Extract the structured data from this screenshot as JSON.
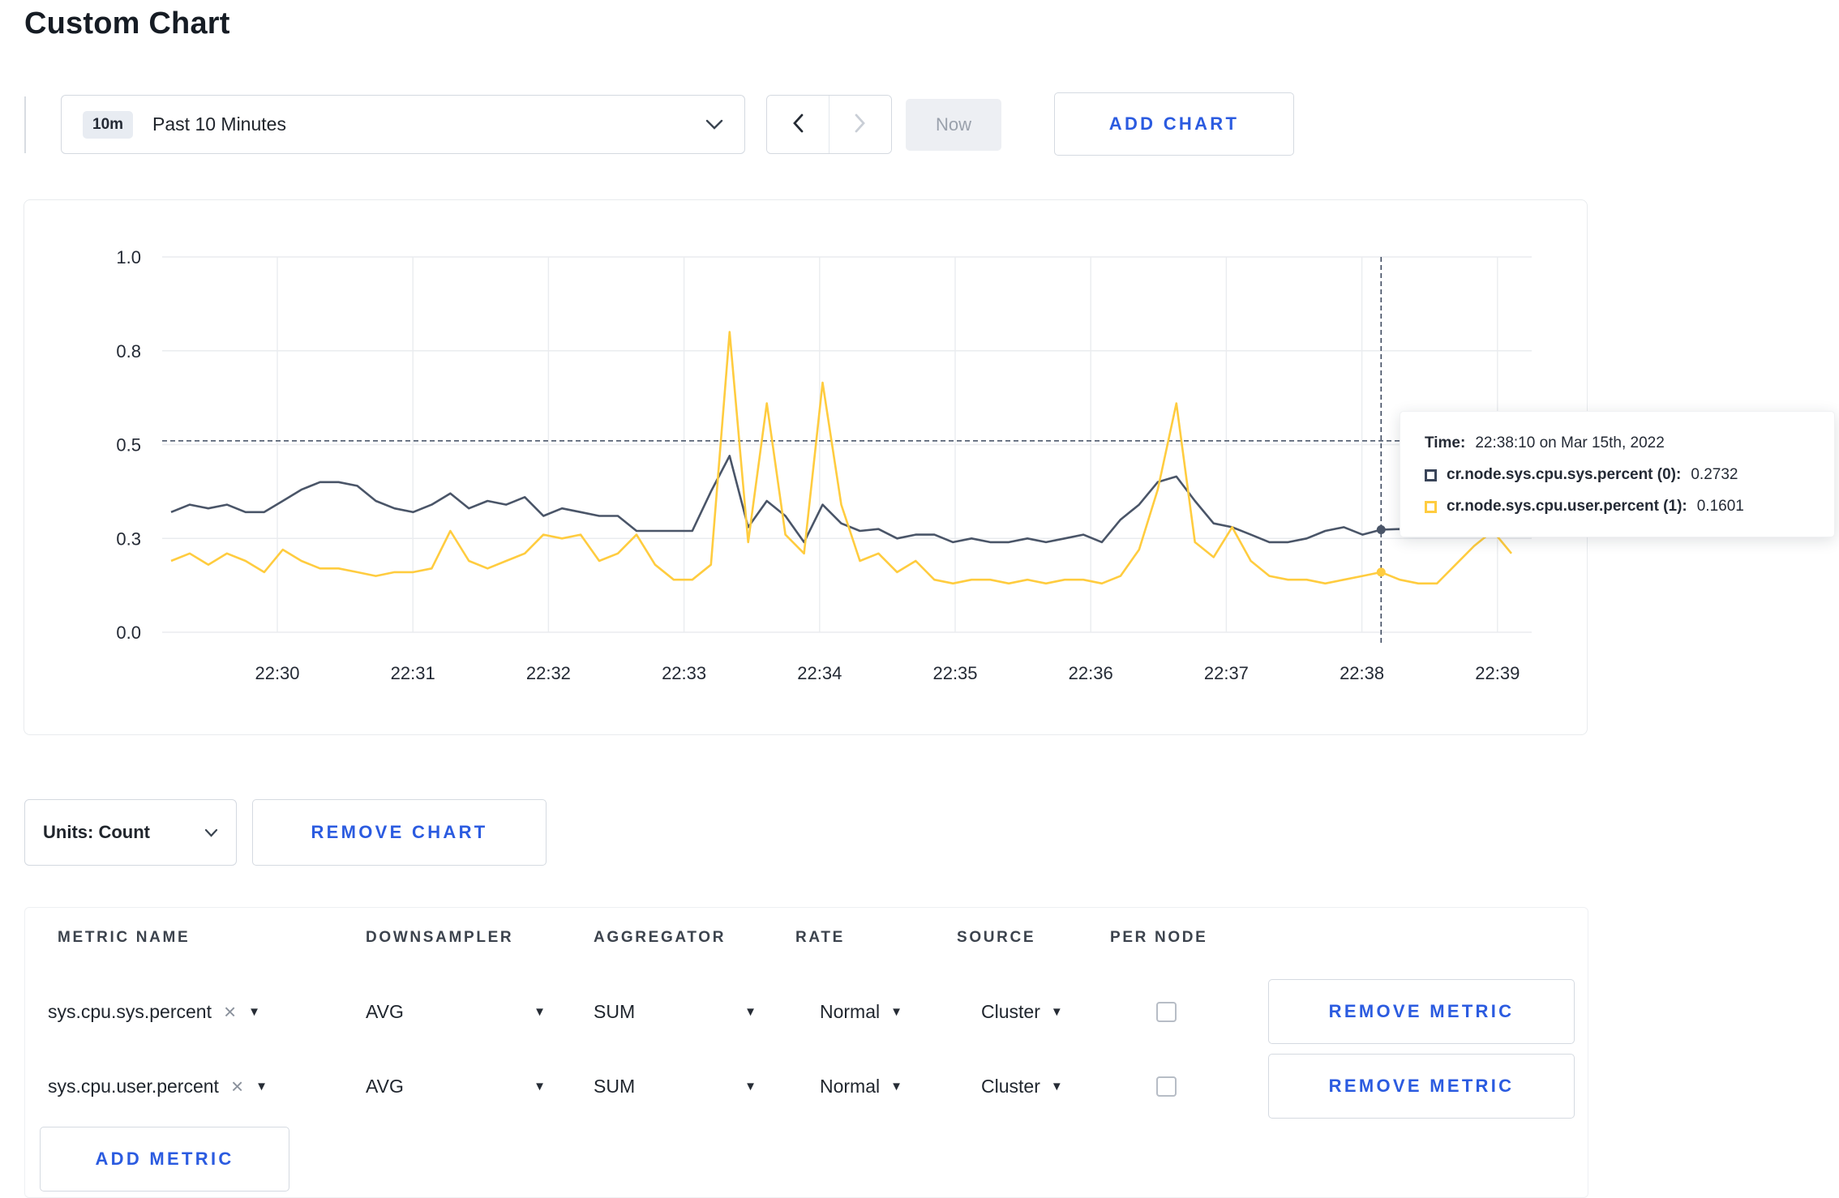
{
  "page": {
    "title": "Custom Chart"
  },
  "toolbar": {
    "time_range": {
      "badge": "10m",
      "label": "Past 10 Minutes"
    },
    "now_label": "Now",
    "add_chart_label": "ADD CHART"
  },
  "chart_data": {
    "type": "line",
    "x_tick_labels": [
      "22:30",
      "22:31",
      "22:32",
      "22:33",
      "22:34",
      "22:35",
      "22:36",
      "22:37",
      "22:38",
      "22:39"
    ],
    "y_ticks": [
      {
        "v": 0,
        "label": "0.0"
      },
      {
        "v": 0.25,
        "label": "0.3"
      },
      {
        "v": 0.5,
        "label": "0.5"
      },
      {
        "v": 0.75,
        "label": "0.8"
      },
      {
        "v": 1,
        "label": "1.0"
      }
    ],
    "ylim": [
      0,
      1
    ],
    "grid": true,
    "series": [
      {
        "name": "cr.node.sys.cpu.sys.percent",
        "color": "#4a5568",
        "values": [
          0.32,
          0.34,
          0.33,
          0.34,
          0.32,
          0.32,
          0.35,
          0.38,
          0.4,
          0.4,
          0.39,
          0.35,
          0.33,
          0.32,
          0.34,
          0.37,
          0.33,
          0.35,
          0.34,
          0.36,
          0.31,
          0.33,
          0.32,
          0.31,
          0.31,
          0.27,
          0.27,
          0.27,
          0.27,
          0.375,
          0.47,
          0.28,
          0.35,
          0.31,
          0.24,
          0.34,
          0.29,
          0.27,
          0.275,
          0.25,
          0.26,
          0.26,
          0.24,
          0.25,
          0.24,
          0.24,
          0.25,
          0.24,
          0.25,
          0.26,
          0.24,
          0.3,
          0.34,
          0.4,
          0.415,
          0.35,
          0.29,
          0.28,
          0.26,
          0.24,
          0.24,
          0.25,
          0.27,
          0.28,
          0.26,
          0.2732,
          0.275,
          0.26,
          0.275,
          0.27,
          0.28,
          0.275,
          0.29
        ]
      },
      {
        "name": "cr.node.sys.cpu.user.percent",
        "color": "#ffcc3f",
        "values": [
          0.19,
          0.21,
          0.18,
          0.21,
          0.19,
          0.16,
          0.22,
          0.19,
          0.17,
          0.17,
          0.16,
          0.15,
          0.16,
          0.16,
          0.17,
          0.27,
          0.19,
          0.17,
          0.19,
          0.21,
          0.26,
          0.25,
          0.26,
          0.19,
          0.21,
          0.26,
          0.18,
          0.14,
          0.14,
          0.18,
          0.8,
          0.24,
          0.61,
          0.26,
          0.21,
          0.665,
          0.34,
          0.19,
          0.21,
          0.16,
          0.19,
          0.14,
          0.13,
          0.14,
          0.14,
          0.13,
          0.14,
          0.13,
          0.14,
          0.14,
          0.13,
          0.15,
          0.22,
          0.38,
          0.61,
          0.24,
          0.2,
          0.28,
          0.19,
          0.15,
          0.14,
          0.14,
          0.13,
          0.14,
          0.15,
          0.1601,
          0.14,
          0.13,
          0.13,
          0.18,
          0.23,
          0.27,
          0.21
        ]
      }
    ],
    "highlight_index": 65,
    "crosshair_value": 0.51,
    "tooltip": {
      "time_label": "Time:",
      "time_value": "22:38:10 on Mar 15th, 2022",
      "entries": [
        {
          "name": "cr.node.sys.cpu.sys.percent (0):",
          "value": "0.2732",
          "color": "#3a4559"
        },
        {
          "name": "cr.node.sys.cpu.user.percent (1):",
          "value": "0.1601",
          "color": "#ffcc3f"
        }
      ]
    }
  },
  "chart_controls": {
    "units_label": "Units: Count",
    "remove_chart_label": "REMOVE CHART"
  },
  "metrics_table": {
    "headers": [
      "METRIC NAME",
      "DOWNSAMPLER",
      "AGGREGATOR",
      "RATE",
      "SOURCE",
      "PER NODE"
    ],
    "rows": [
      {
        "metric": "sys.cpu.sys.percent",
        "downsampler": "AVG",
        "aggregator": "SUM",
        "rate": "Normal",
        "source": "Cluster",
        "per_node": false,
        "remove_label": "REMOVE METRIC"
      },
      {
        "metric": "sys.cpu.user.percent",
        "downsampler": "AVG",
        "aggregator": "SUM",
        "rate": "Normal",
        "source": "Cluster",
        "per_node": false,
        "remove_label": "REMOVE METRIC"
      }
    ],
    "add_metric_label": "ADD METRIC"
  }
}
